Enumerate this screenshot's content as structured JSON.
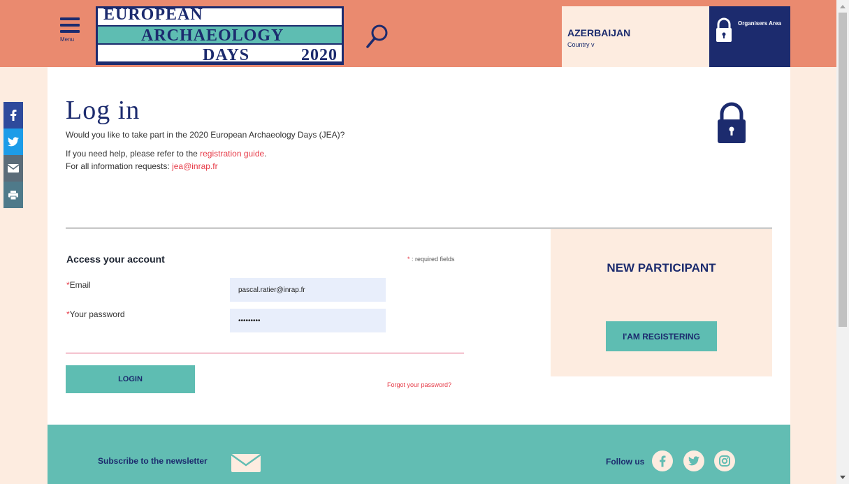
{
  "header": {
    "menu_label": "Menu",
    "logo": {
      "line1": "EUROPEAN",
      "line2": "ARCHAEOLOGY",
      "line3": "DAYS",
      "year": "2020"
    },
    "country": {
      "name": "AZERBAIJAN",
      "sub": "Country v"
    },
    "organisers_label": "Organisers Area"
  },
  "social": [
    "facebook",
    "twitter",
    "email",
    "print"
  ],
  "page": {
    "title": "Log in",
    "intro": "Would you like to take part in the 2020 European Archaeology Days (JEA)?",
    "help_prefix": "If you need help, please refer to the ",
    "help_link": "registration guide",
    "help_suffix": ".",
    "info_prefix": "For all information requests: ",
    "info_email": "jea@inrap.fr"
  },
  "form": {
    "section_title": "Access your account",
    "required_star": "*",
    "required_text": " : required fields",
    "email_label": "Email",
    "email_value": "pascal.ratier@inrap.fr",
    "password_label": "Your password",
    "password_value": "password1",
    "login_label": "LOGIN",
    "forgot_label": "Forgot your password?"
  },
  "new_participant": {
    "title": "NEW PARTICIPANT",
    "button_label": "I'AM REGISTERING"
  },
  "footer": {
    "newsletter": "Subscribe to the newsletter",
    "follow": "Follow us"
  },
  "colors": {
    "header_bg": "#ea8a6f",
    "navy": "#1c2b6e",
    "teal": "#5ebdb2",
    "cream": "#fdece0",
    "accent_red": "#e63946"
  }
}
